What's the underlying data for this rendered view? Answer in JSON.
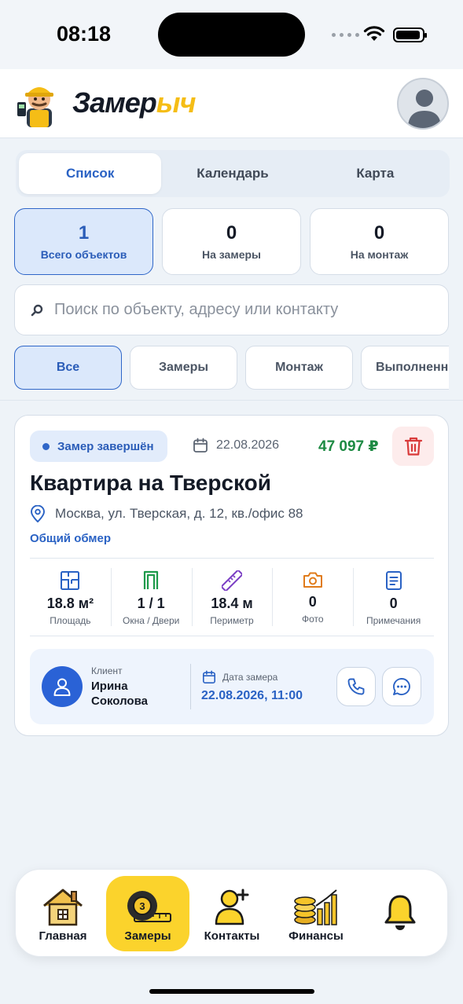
{
  "status_bar": {
    "time": "08:18"
  },
  "header": {
    "logo_part1": "Замер",
    "logo_part2": "ыч"
  },
  "tabs": [
    {
      "label": "Список",
      "active": true
    },
    {
      "label": "Календарь",
      "active": false
    },
    {
      "label": "Карта",
      "active": false
    }
  ],
  "stats": [
    {
      "value": "1",
      "label": "Всего объектов",
      "active": true
    },
    {
      "value": "0",
      "label": "На замеры",
      "active": false
    },
    {
      "value": "0",
      "label": "На монтаж",
      "active": false
    }
  ],
  "search": {
    "placeholder": "Поиск по объекту, адресу или контакту",
    "value": ""
  },
  "filters": [
    {
      "label": "Все",
      "active": true
    },
    {
      "label": "Замеры",
      "active": false
    },
    {
      "label": "Монтаж",
      "active": false
    },
    {
      "label": "Выполненные",
      "active": false
    }
  ],
  "card": {
    "status": "Замер завершён",
    "date": "22.08.2026",
    "price": "47 097 ₽",
    "title": "Квартира на Тверской",
    "address": "Москва, ул. Тверская, д. 12, кв./офис 88",
    "scope": "Общий обмер",
    "metrics": [
      {
        "value": "18.8 м²",
        "label": "Площадь",
        "icon": "floor-plan-icon",
        "color": "#2a62c4"
      },
      {
        "value": "1 / 1",
        "label": "Окна / Двери",
        "icon": "door-icon",
        "color": "#1d9a4a"
      },
      {
        "value": "18.4 м",
        "label": "Периметр",
        "icon": "ruler-icon",
        "color": "#7b3fc4"
      },
      {
        "value": "0",
        "label": "Фото",
        "icon": "camera-icon",
        "color": "#e07b1a"
      },
      {
        "value": "0",
        "label": "Примечания",
        "icon": "document-icon",
        "color": "#2a62c4"
      }
    ],
    "client": {
      "caption": "Клиент",
      "name": "Ирина Соколова",
      "date_caption": "Дата замера",
      "date_value": "22.08.2026, 11:00"
    }
  },
  "bottom_nav": [
    {
      "label": "Главная",
      "icon": "house-icon",
      "active": false
    },
    {
      "label": "Замеры",
      "icon": "tape-measure-icon",
      "active": true
    },
    {
      "label": "Контакты",
      "icon": "add-contact-icon",
      "active": false
    },
    {
      "label": "Финансы",
      "icon": "coins-chart-icon",
      "active": false
    },
    {
      "label": "",
      "icon": "bell-icon",
      "active": false
    }
  ],
  "colors": {
    "accent": "#2a62c4",
    "brand_yellow": "#fbd32c",
    "price_green": "#1d8a43",
    "danger": "#d93a3a"
  }
}
